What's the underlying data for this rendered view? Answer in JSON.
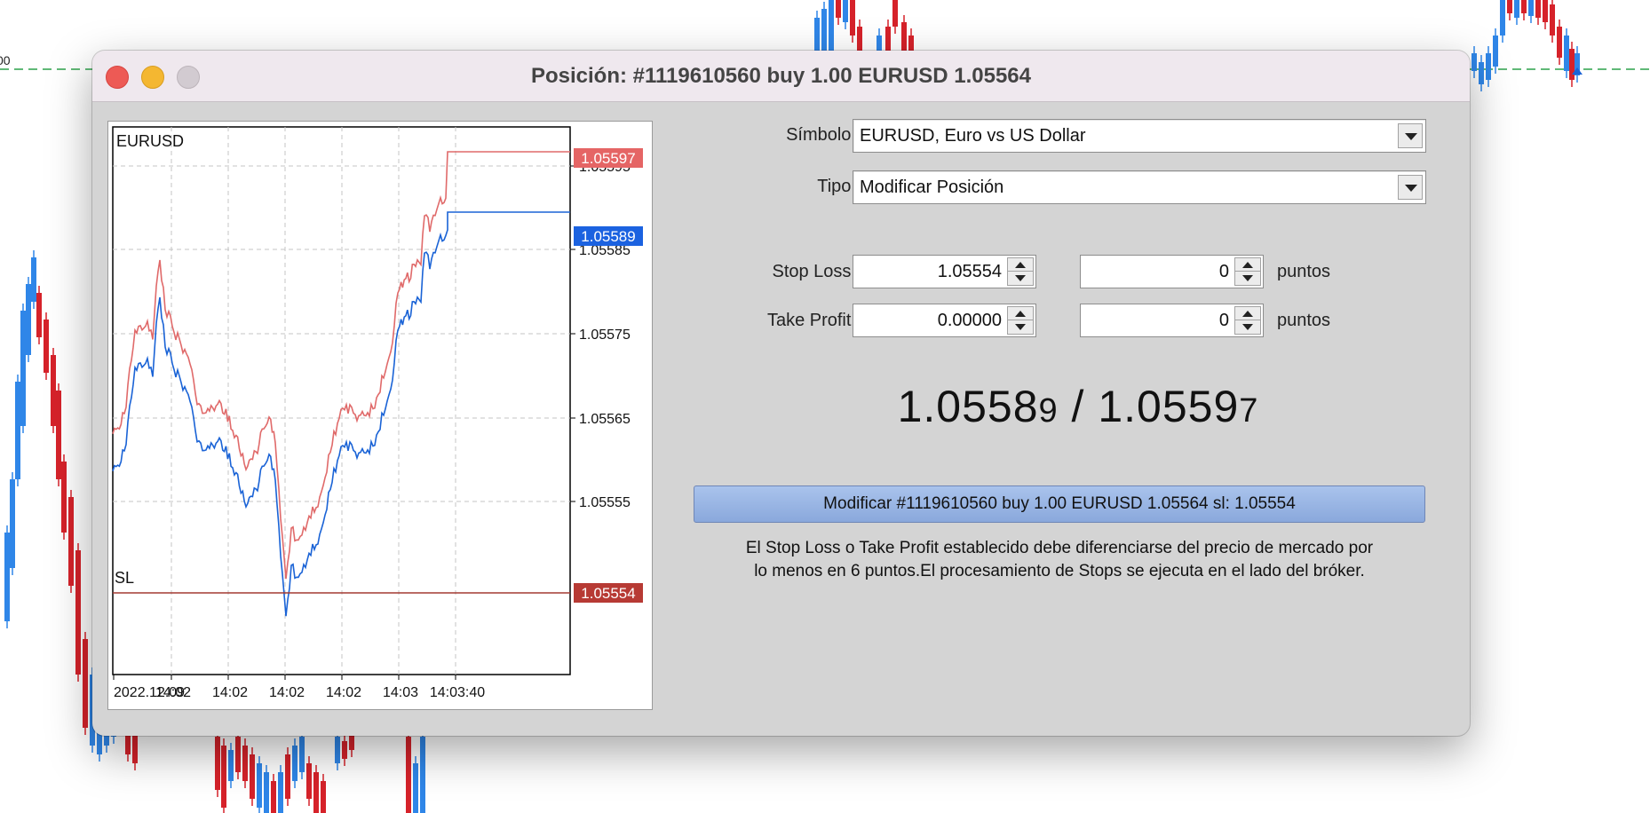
{
  "window": {
    "title": "Posición: #1119610560 buy 1.00 EURUSD 1.05564"
  },
  "background_chart": {
    "axis_fragment": "00",
    "colors": {
      "up": "#2f86e8",
      "down": "#d6222a",
      "level": "#2ca24a"
    }
  },
  "mini_chart": {
    "symbol": "EURUSD",
    "sl_tag": "SL",
    "price_ticks": [
      "1.05595",
      "1.05585",
      "1.05575",
      "1.05565",
      "1.05555"
    ],
    "time_ticks": [
      "2022.12.09",
      "14:02",
      "14:02",
      "14:02",
      "14:02",
      "14:03",
      "14:03:40"
    ],
    "ask_label": "1.05597",
    "bid_label": "1.05589",
    "sl_label": "1.05554",
    "colors": {
      "ask": "#e06a6a",
      "bid": "#1a63d6",
      "sl_line": "#a33a32",
      "ask_tag": "#e56565",
      "bid_tag": "#1b62e0",
      "sl_tag": "#b73a34"
    }
  },
  "form": {
    "symbol_label": "Símbolo:",
    "symbol_value": "EURUSD, Euro vs US Dollar",
    "type_label": "Tipo:",
    "type_value": "Modificar Posición",
    "stop_loss_label": "Stop Loss:",
    "stop_loss_value": "1.05554",
    "stop_loss_points": "0",
    "take_profit_label": "Take Profit:",
    "take_profit_value": "0.00000",
    "take_profit_points": "0",
    "points_unit": "puntos"
  },
  "quote": {
    "bid_main": "1.0558",
    "bid_small": "9",
    "separator": " / ",
    "ask_main": "1.0559",
    "ask_small": "7"
  },
  "action_button": "Modificar #1119610560 buy 1.00 EURUSD 1.05564 sl: 1.05554",
  "note_lines": [
    "El Stop Loss o Take Profit establecido debe diferenciarse del precio de mercado por",
    "lo menos en 6 puntos.El procesamiento de Stops se ejecuta en el lado del bróker."
  ]
}
